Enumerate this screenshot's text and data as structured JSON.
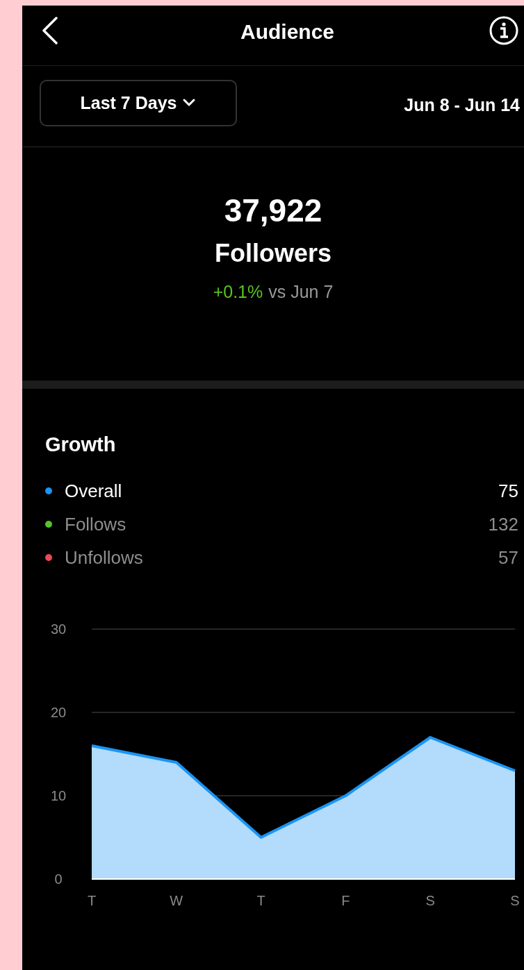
{
  "header": {
    "title": "Audience"
  },
  "filter": {
    "range": "Last 7 Days",
    "dates": "Jun 8 - Jun 14"
  },
  "summary": {
    "count": "37,922",
    "label": "Followers",
    "change": "+0.1%",
    "comparison": "vs Jun 7"
  },
  "growth": {
    "title": "Growth",
    "legend": [
      {
        "label": "Overall",
        "value": "75",
        "color": "#1a94f5",
        "selected": true
      },
      {
        "label": "Follows",
        "value": "132",
        "color": "#57c22e",
        "selected": false
      },
      {
        "label": "Unfollows",
        "value": "57",
        "color": "#ed4956",
        "selected": false
      }
    ],
    "chart_data": {
      "type": "area",
      "categories": [
        "T",
        "W",
        "T",
        "F",
        "S",
        "S"
      ],
      "series": [
        {
          "color": "#1a94f5",
          "values": [
            16,
            14,
            5,
            10,
            17,
            13
          ]
        }
      ],
      "ylim": [
        0,
        30
      ],
      "yticks": [
        0,
        10,
        20,
        30
      ]
    }
  }
}
